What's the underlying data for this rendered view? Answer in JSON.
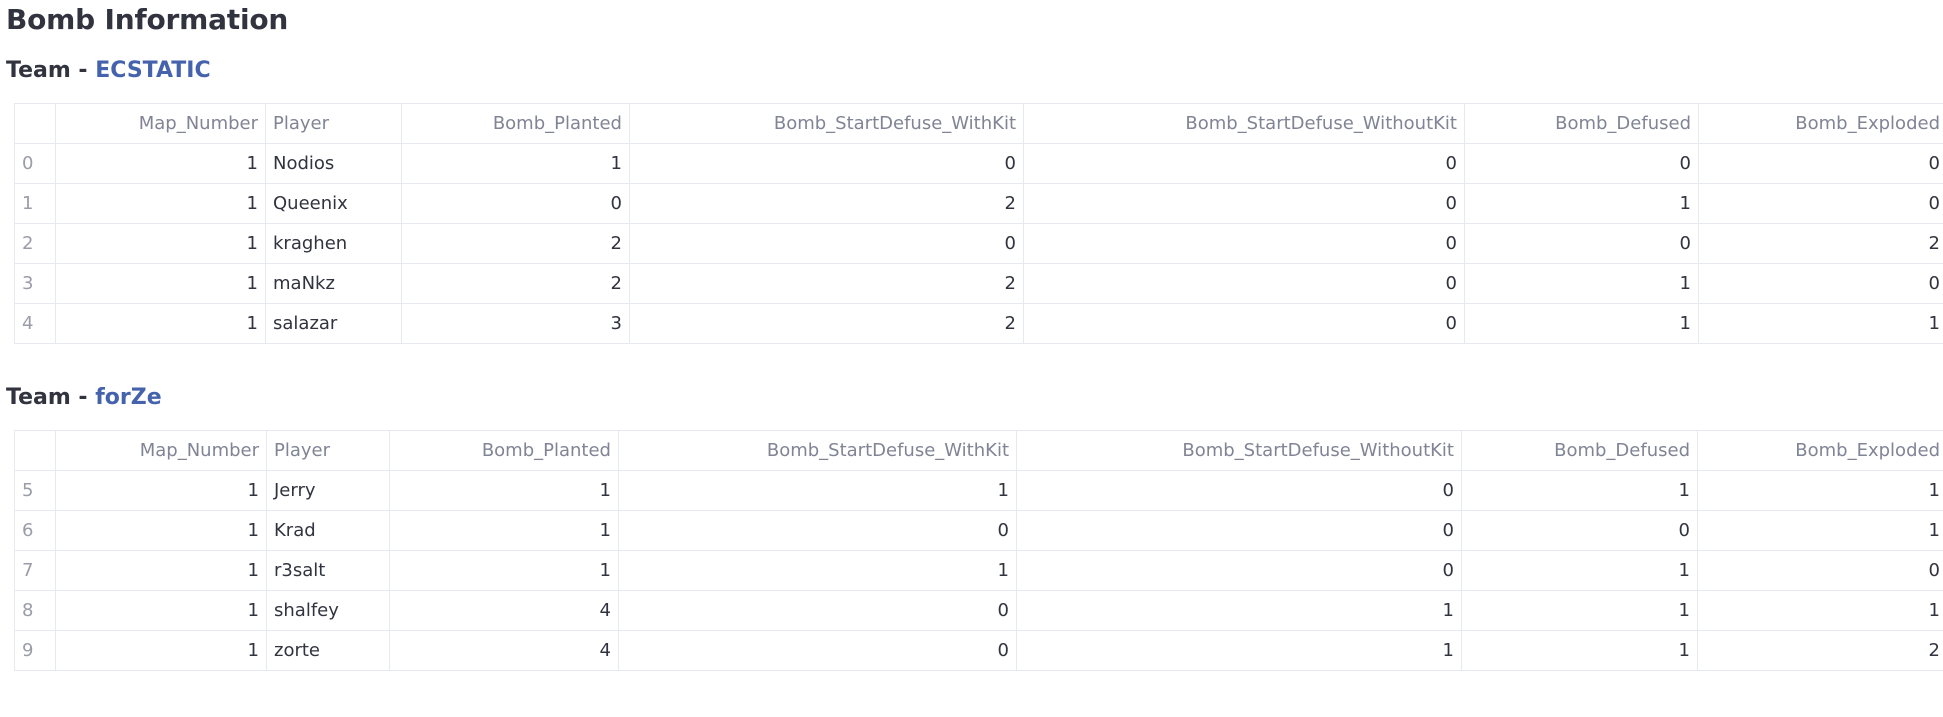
{
  "page": {
    "title": "Bomb Information"
  },
  "columns": [
    "",
    "Map_Number",
    "Player",
    "Bomb_Planted",
    "Bomb_StartDefuse_WithKit",
    "Bomb_StartDefuse_WithoutKit",
    "Bomb_Defused",
    "Bomb_Exploded"
  ],
  "teams": [
    {
      "prefix": "Team - ",
      "name": "ECSTATIC",
      "rows": [
        {
          "index": "0",
          "Map_Number": "1",
          "Player": "Nodios",
          "Bomb_Planted": "1",
          "Bomb_StartDefuse_WithKit": "0",
          "Bomb_StartDefuse_WithoutKit": "0",
          "Bomb_Defused": "0",
          "Bomb_Exploded": "0"
        },
        {
          "index": "1",
          "Map_Number": "1",
          "Player": "Queenix",
          "Bomb_Planted": "0",
          "Bomb_StartDefuse_WithKit": "2",
          "Bomb_StartDefuse_WithoutKit": "0",
          "Bomb_Defused": "1",
          "Bomb_Exploded": "0"
        },
        {
          "index": "2",
          "Map_Number": "1",
          "Player": "kraghen",
          "Bomb_Planted": "2",
          "Bomb_StartDefuse_WithKit": "0",
          "Bomb_StartDefuse_WithoutKit": "0",
          "Bomb_Defused": "0",
          "Bomb_Exploded": "2"
        },
        {
          "index": "3",
          "Map_Number": "1",
          "Player": "maNkz",
          "Bomb_Planted": "2",
          "Bomb_StartDefuse_WithKit": "2",
          "Bomb_StartDefuse_WithoutKit": "0",
          "Bomb_Defused": "1",
          "Bomb_Exploded": "0"
        },
        {
          "index": "4",
          "Map_Number": "1",
          "Player": "salazar",
          "Bomb_Planted": "3",
          "Bomb_StartDefuse_WithKit": "2",
          "Bomb_StartDefuse_WithoutKit": "0",
          "Bomb_Defused": "1",
          "Bomb_Exploded": "1"
        }
      ]
    },
    {
      "prefix": "Team - ",
      "name": "forZe",
      "rows": [
        {
          "index": "5",
          "Map_Number": "1",
          "Player": "Jerry",
          "Bomb_Planted": "1",
          "Bomb_StartDefuse_WithKit": "1",
          "Bomb_StartDefuse_WithoutKit": "0",
          "Bomb_Defused": "1",
          "Bomb_Exploded": "1"
        },
        {
          "index": "6",
          "Map_Number": "1",
          "Player": "Krad",
          "Bomb_Planted": "1",
          "Bomb_StartDefuse_WithKit": "0",
          "Bomb_StartDefuse_WithoutKit": "0",
          "Bomb_Defused": "0",
          "Bomb_Exploded": "1"
        },
        {
          "index": "7",
          "Map_Number": "1",
          "Player": "r3salt",
          "Bomb_Planted": "1",
          "Bomb_StartDefuse_WithKit": "1",
          "Bomb_StartDefuse_WithoutKit": "0",
          "Bomb_Defused": "1",
          "Bomb_Exploded": "0"
        },
        {
          "index": "8",
          "Map_Number": "1",
          "Player": "shalfey",
          "Bomb_Planted": "4",
          "Bomb_StartDefuse_WithKit": "0",
          "Bomb_StartDefuse_WithoutKit": "1",
          "Bomb_Defused": "1",
          "Bomb_Exploded": "1"
        },
        {
          "index": "9",
          "Map_Number": "1",
          "Player": "zorte",
          "Bomb_Planted": "4",
          "Bomb_StartDefuse_WithKit": "0",
          "Bomb_StartDefuse_WithoutKit": "1",
          "Bomb_Defused": "1",
          "Bomb_Exploded": "2"
        }
      ]
    }
  ],
  "colors": {
    "text": "#31333f",
    "team_name": "#4562ad",
    "header_text": "#808495",
    "index_text": "#9a9ca8",
    "border": "#e6e9ef"
  }
}
